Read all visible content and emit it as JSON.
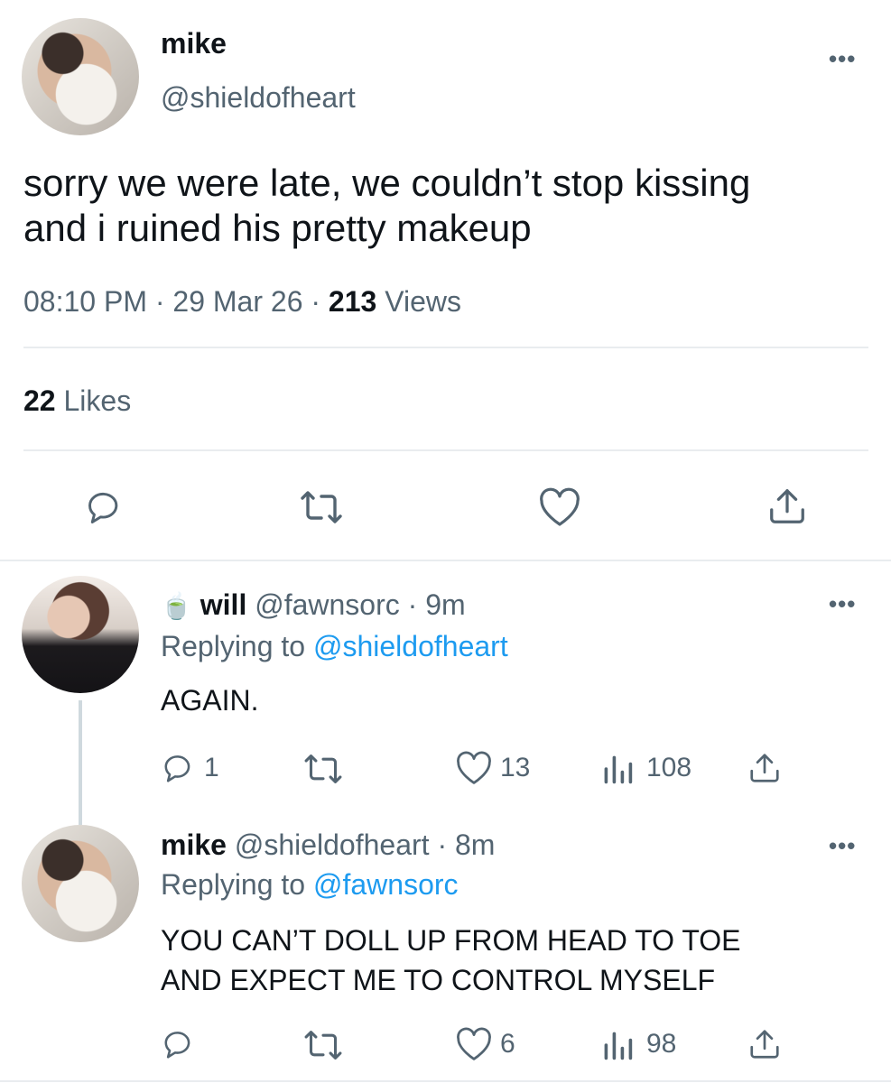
{
  "main_tweet": {
    "name": "mike",
    "handle": "@shieldofheart",
    "text_line1": "sorry we were late, we couldn’t stop kissing",
    "text_line2": "and i ruined his pretty makeup",
    "time": "08:10 PM",
    "date": "29 Mar 26",
    "views_count": "213",
    "views_label": "Views",
    "likes_count": "22",
    "likes_label": "Likes"
  },
  "reply1": {
    "emoji": "🍵",
    "name": "will",
    "handle": "@fawnsorc",
    "time": "9m",
    "replying_label": "Replying to",
    "replying_handle": "@shieldofheart",
    "text": "AGAIN.",
    "replies": "1",
    "likes": "13",
    "views": "108"
  },
  "reply2": {
    "name": "mike",
    "handle": "@shieldofheart",
    "time": "8m",
    "replying_label": "Replying to",
    "replying_handle": "@fawnsorc",
    "text_line1": "YOU CAN’T DOLL UP FROM HEAD TO TOE",
    "text_line2": "AND EXPECT ME TO CONTROL MYSELF",
    "likes": "6",
    "views": "98"
  },
  "separator": "·",
  "more_glyph": "•••",
  "icons": [
    "reply-icon",
    "retweet-icon",
    "like-icon",
    "share-icon",
    "views-icon",
    "more-icon"
  ],
  "colors": {
    "text": "#0f1419",
    "secondary": "#536471",
    "link": "#1d9bf0",
    "divider": "#e9ecef"
  }
}
